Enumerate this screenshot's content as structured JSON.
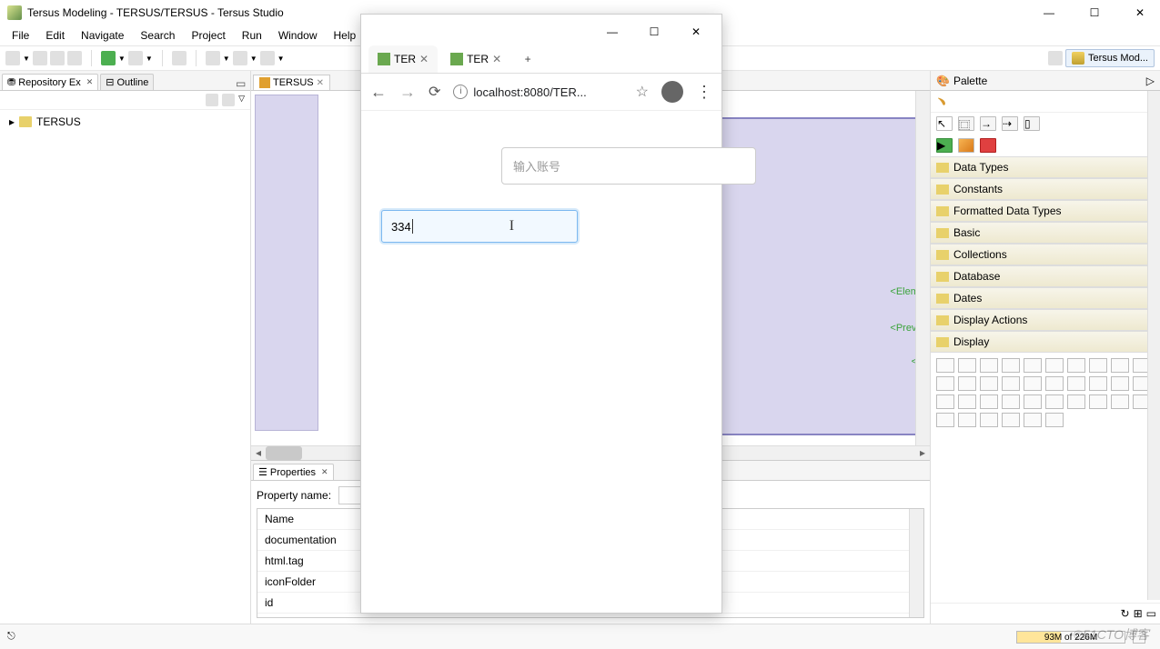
{
  "window": {
    "title": "Tersus Modeling - TERSUS/TERSUS - Tersus Studio"
  },
  "menu": [
    "File",
    "Edit",
    "Navigate",
    "Search",
    "Project",
    "Run",
    "Window",
    "Help"
  ],
  "perspective": {
    "label": "Tersus Mod..."
  },
  "views": {
    "repo": {
      "label": "Repository Ex"
    },
    "outline": {
      "label": "Outline"
    }
  },
  "tree": {
    "root": "TERSUS"
  },
  "editor": {
    "tab": "TERSUS"
  },
  "canvas_labels": {
    "elem": "<Eleme",
    "prev": "<Previo",
    "next": "<N"
  },
  "props": {
    "tab": "Properties",
    "name_label": "Property name:",
    "name_value": "",
    "rows": [
      "Name",
      "documentation",
      "html.tag",
      "iconFolder",
      "id"
    ]
  },
  "palette": {
    "title": "Palette",
    "cats": [
      "Data Types",
      "Constants",
      "Formatted Data Types",
      "Basic",
      "Collections",
      "Database",
      "Dates",
      "Display Actions",
      "Display"
    ]
  },
  "status": {
    "mem": "93M of 226M"
  },
  "watermark": "©51CTO博客",
  "browser": {
    "tabs": [
      {
        "label": "TER",
        "active": false
      },
      {
        "label": "TER",
        "active": true
      }
    ],
    "address": "localhost:8080/TER...",
    "field1_placeholder": "输入账号",
    "field2_value": "334"
  }
}
